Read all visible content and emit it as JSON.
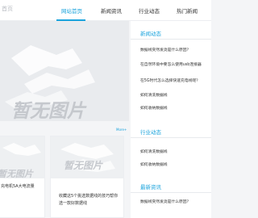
{
  "header": {
    "logo_text": "首页",
    "nav": [
      "网站首页",
      "新闻资讯",
      "行业动态",
      "热门新闻"
    ]
  },
  "placeholder": {
    "main_text": "暂无图片",
    "card_text": "暂无图片"
  },
  "more": "More+",
  "cards": [
    {
      "title": "充电机5A大电流量"
    },
    {
      "title": "收藏这5个挑选数据线的技巧帮你选一款好数据线"
    }
  ],
  "sidebar": {
    "sections": [
      {
        "title": "新闻动态",
        "items": [
          "数据线突然发烫是什么原因？",
          "在自然环境中要怎么使用usb连接器",
          "在5G时代怎么选择快速充电线呢？",
          "如何清洗数据线",
          "如何收纳数据线"
        ]
      },
      {
        "title": "行业动态",
        "items": [
          "如何清洗数据线",
          "如何收纳数据线"
        ]
      },
      {
        "title": "最新资讯",
        "items": [
          "数据线突然发烫是什么原因？"
        ]
      }
    ]
  },
  "colors": {
    "accent": "#1aa3dc",
    "placeholder_text": "#c5c8cd"
  }
}
